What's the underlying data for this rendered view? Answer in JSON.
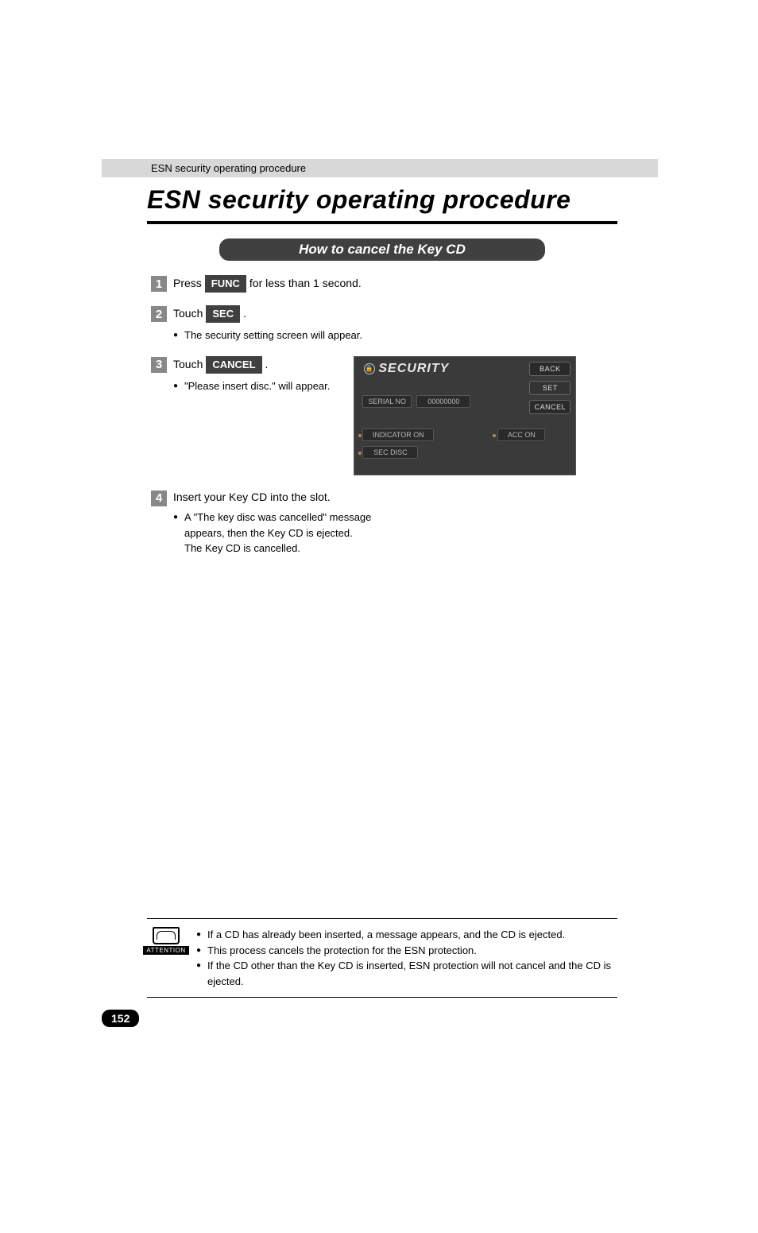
{
  "header": {
    "breadcrumb": "ESN security operating procedure"
  },
  "title": "ESN security operating procedure",
  "section_title": "How to cancel the Key CD",
  "steps": [
    {
      "num": "1",
      "prefix": "Press",
      "button": "FUNC",
      "suffix": "for less than 1 second."
    },
    {
      "num": "2",
      "prefix": "Touch",
      "button": "SEC",
      "suffix": ".",
      "bullets": [
        "The security setting screen will appear."
      ]
    },
    {
      "num": "3",
      "prefix": "Touch",
      "button": "CANCEL",
      "suffix": ".",
      "bullets": [
        "\"Please insert disc.\" will appear."
      ]
    },
    {
      "num": "4",
      "line": "Insert your Key CD into the slot.",
      "bullets": [
        "A \"The key disc was cancelled\" message appears, then the Key CD is ejected."
      ],
      "continuation": "The Key CD is cancelled."
    }
  ],
  "security_panel": {
    "title": "SECURITY",
    "buttons": {
      "back": "BACK",
      "set": "SET",
      "cancel": "CANCEL"
    },
    "serial_label": "SERIAL NO",
    "serial_value": "00000000",
    "indicator": "INDICATOR ON",
    "acc": "ACC ON",
    "secdisc": "SEC DISC"
  },
  "attention": {
    "label": "ATTENTION",
    "items": [
      "If a CD has already been inserted, a message appears, and the CD is ejected.",
      "This process cancels the protection for the ESN protection.",
      "If the CD other than the Key CD is inserted, ESN protection will not cancel and the CD is ejected."
    ]
  },
  "page_number": "152"
}
